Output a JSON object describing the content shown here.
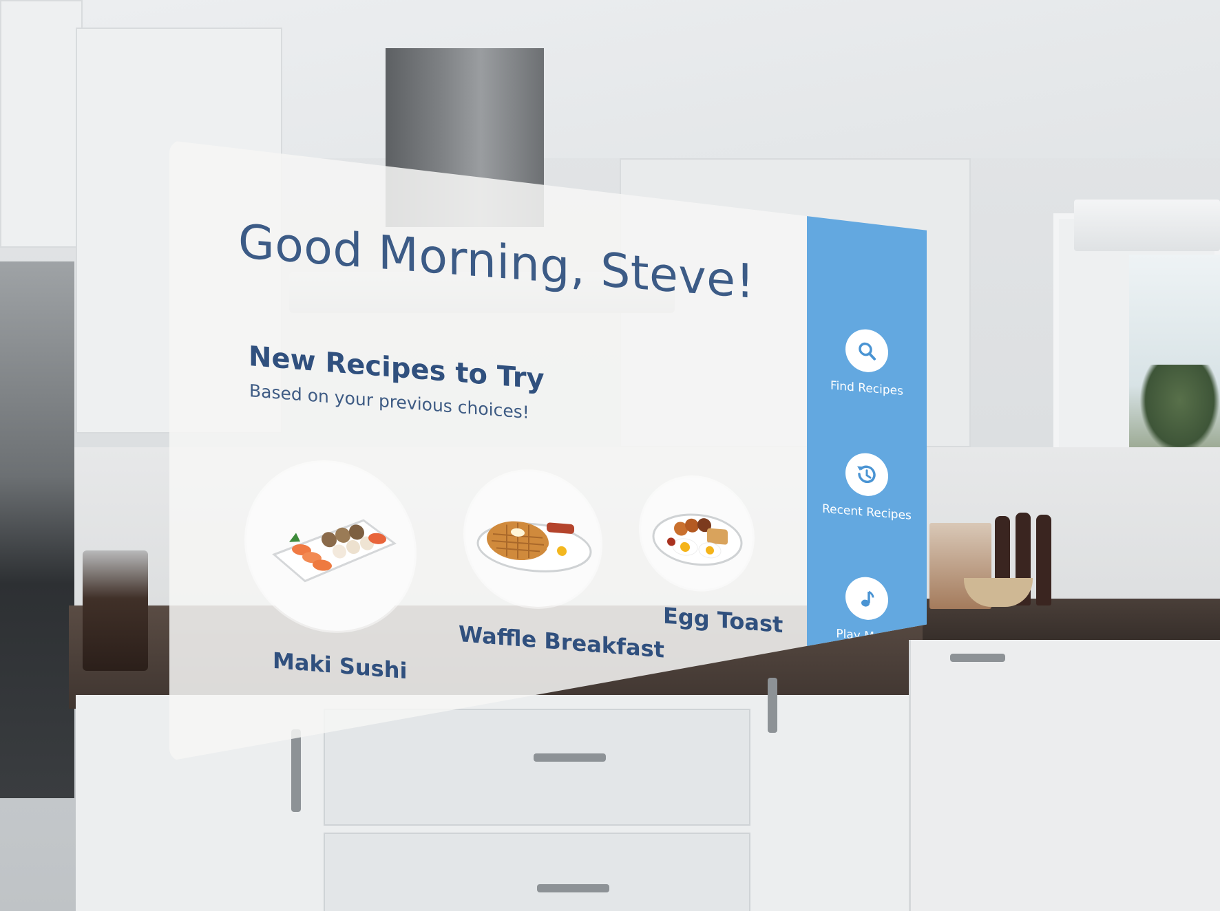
{
  "greeting": "Good Morning, Steve!",
  "recipes_section": {
    "title": "New Recipes to Try",
    "subtitle": "Based on your previous choices!",
    "items": [
      {
        "label": "Maki Sushi",
        "image": "sushi-plate"
      },
      {
        "label": "Waffle Breakfast",
        "image": "waffle-plate"
      },
      {
        "label": "Egg Toast",
        "image": "egg-toast-plate"
      }
    ]
  },
  "sidebar": {
    "items": [
      {
        "label": "Find Recipes",
        "icon": "search-icon"
      },
      {
        "label": "Recent Recipes",
        "icon": "history-icon"
      },
      {
        "label": "Play Music",
        "icon": "music-note-icon"
      }
    ]
  },
  "colors": {
    "accent_blue": "#63a8e0",
    "text_navy": "#30507e",
    "panel_bg": "#f6f6f4"
  }
}
